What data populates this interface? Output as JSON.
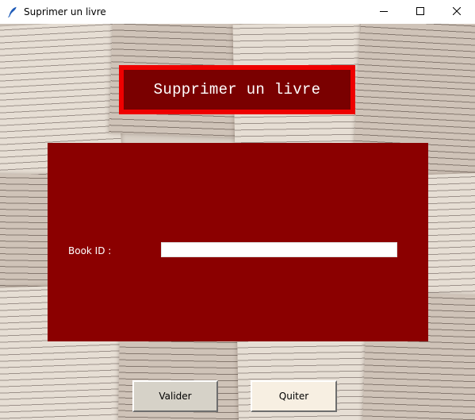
{
  "window": {
    "title": "Suprimer un livre",
    "icon": "feather-icon"
  },
  "controls": {
    "minimize_icon": "minimize-icon",
    "maximize_icon": "maximize-icon",
    "close_icon": "close-icon"
  },
  "heading": {
    "text": "Supprimer un livre"
  },
  "form": {
    "book_id_label": "Book ID :",
    "book_id_value": ""
  },
  "buttons": {
    "submit_label": "Valider",
    "quit_label": "Quiter"
  },
  "colors": {
    "panel": "#8b0000",
    "heading_border": "#ee0000",
    "heading_fill": "#7a0000",
    "submit_bg": "#d6d2c8",
    "quit_bg": "#f7efe2"
  }
}
